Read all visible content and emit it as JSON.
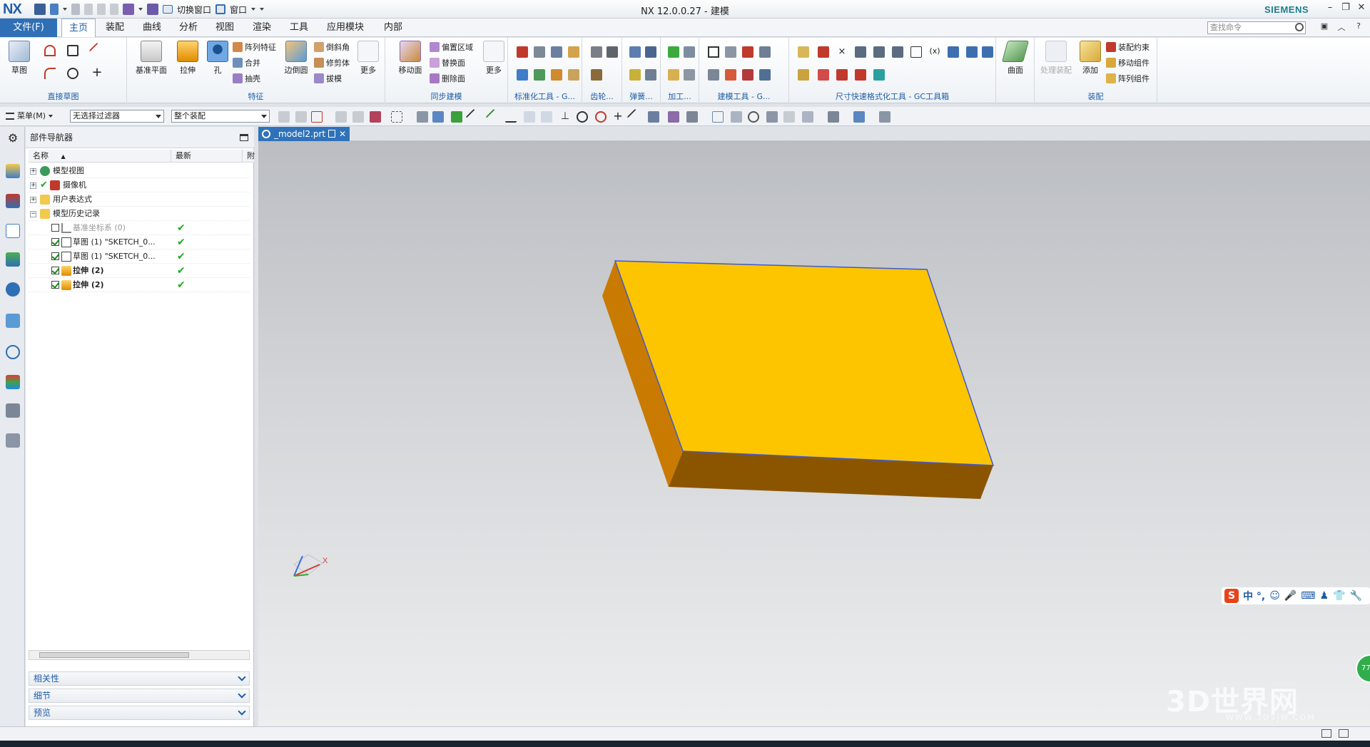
{
  "app": {
    "logo": "NX",
    "title": "NX 12.0.0.27 - 建模",
    "brand": "SIEMENS",
    "accent": "#2f6fb5"
  },
  "quick_access": {
    "switch_window": "切换窗口",
    "window": "窗口"
  },
  "menu": {
    "file": "文件(F)",
    "tabs": [
      "主页",
      "装配",
      "曲线",
      "分析",
      "视图",
      "渲染",
      "工具",
      "应用模块",
      "内部"
    ],
    "active_tab": "主页",
    "search_placeholder": "查找命令"
  },
  "ribbon": {
    "groups": {
      "direct_sketch": "直接草图",
      "feature": "特征",
      "sync_modeling": "同步建模",
      "std_tools": "标准化工具 - G...",
      "gear": "齿轮...",
      "spring": "弹簧...",
      "machining": "加工...",
      "modeling_tools": "建模工具 - G...",
      "dim_tools": "尺寸快速格式化工具 - GC工具箱",
      "assembly": "装配"
    },
    "buttons": {
      "sketch": "草图",
      "datum_plane": "基准平面",
      "extrude": "拉伸",
      "hole": "孔",
      "pattern_feature": "阵列特征",
      "unite": "合并",
      "shell": "抽壳",
      "edge_blend": "边倒圆",
      "chamfer": "倒斜角",
      "trim_body": "修剪体",
      "draft": "拔模",
      "more_feature": "更多",
      "move_face": "移动面",
      "offset_region": "偏置区域",
      "replace_face": "替换面",
      "delete_face": "删除面",
      "more_sync": "更多",
      "surface": "曲面",
      "process_assembly": "处理装配",
      "add": "添加",
      "assembly_constraints": "装配约束",
      "move_component": "移动组件",
      "pattern_component": "阵列组件"
    }
  },
  "selection_bar": {
    "menu": "菜单(M)",
    "filter": "无选择过滤器",
    "scope": "整个装配"
  },
  "navigator": {
    "title": "部件导航器",
    "col_name": "名称",
    "col_latest": "最新",
    "col_extra": "附",
    "rows": [
      {
        "label": "模型视图",
        "latest": ""
      },
      {
        "label": "摄像机",
        "latest": ""
      },
      {
        "label": "用户表达式",
        "latest": ""
      },
      {
        "label": "模型历史记录",
        "latest": ""
      },
      {
        "label": "基准坐标系 (0)",
        "latest": "✔"
      },
      {
        "label": "草图 (1) \"SKETCH_0...",
        "latest": "✔"
      },
      {
        "label": "草图 (1) \"SKETCH_0...",
        "latest": "✔"
      },
      {
        "label": "拉伸 (2)",
        "latest": "✔"
      },
      {
        "label": "拉伸 (2)",
        "latest": "✔"
      }
    ],
    "panels": [
      "相关性",
      "细节",
      "预览"
    ]
  },
  "document": {
    "tab": "_model2.prt"
  },
  "viewport": {
    "triad_x": "X",
    "part_top_color": "#fdc500",
    "part_side_color": "#c97a00",
    "part_front_color": "#8b5500",
    "ime_label": "中 °,",
    "badge": "77",
    "watermark": "3D世界网",
    "watermark_sub": "WWW.3DSJW.COM"
  }
}
